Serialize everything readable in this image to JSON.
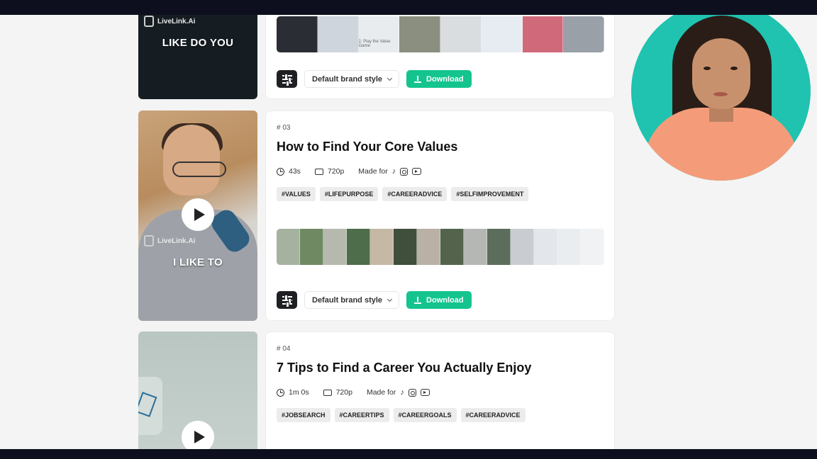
{
  "brand": {
    "name": "LiveLink.Ai"
  },
  "colors": {
    "accent": "#14c48e",
    "avatar_bg": "#1fc3b0",
    "bar": "#0d0f1e"
  },
  "cards": [
    {
      "thumb_caption": "LIKE DO YOU",
      "style_label": "Default brand style",
      "download_label": "Download"
    },
    {
      "number": "# 03",
      "title": "How to Find Your Core Values",
      "duration": "43s",
      "resolution": "720p",
      "made_for_label": "Made for",
      "tags": [
        "#VALUES",
        "#LIFEPURPOSE",
        "#CAREERADVICE",
        "#SELFIMPROVEMENT"
      ],
      "thumb_caption": "I LIKE TO",
      "style_label": "Default brand style",
      "download_label": "Download"
    },
    {
      "number": "# 04",
      "title": "7 Tips to Find a Career You Actually Enjoy",
      "duration": "1m 0s",
      "resolution": "720p",
      "made_for_label": "Made for",
      "tags": [
        "#JOBSEARCH",
        "#CAREERTIPS",
        "#CAREERGOALS",
        "#CAREERADVICE"
      ]
    }
  ],
  "strip_1": {
    "text": "2. Play the Value Game"
  }
}
